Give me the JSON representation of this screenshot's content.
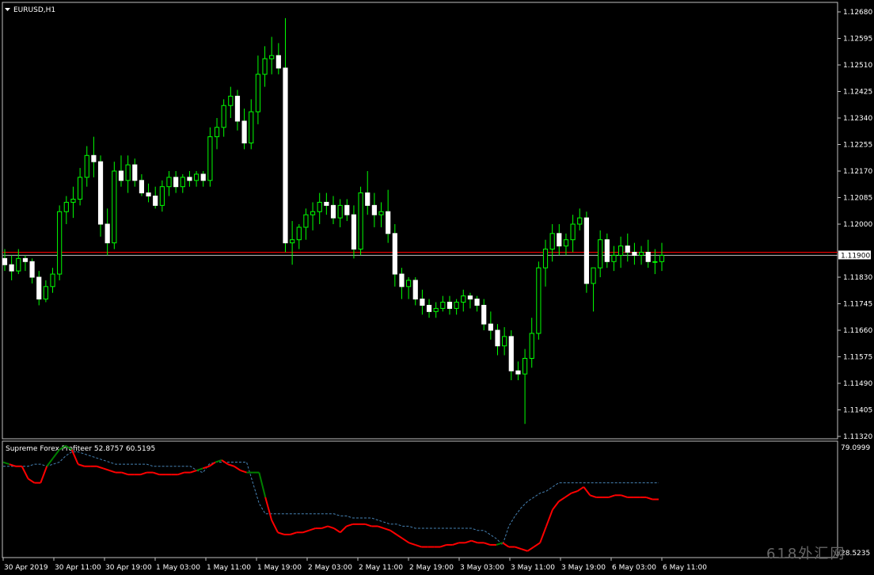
{
  "chart_data": {
    "type": "candlestick",
    "symbol_label": "EURUSD,H1",
    "price_axis_ticks": [
      "1.12680",
      "1.12595",
      "1.12510",
      "1.12425",
      "1.12340",
      "1.12255",
      "1.12170",
      "1.12085",
      "1.12000",
      "1.11830",
      "1.11745",
      "1.11660",
      "1.11575",
      "1.11490",
      "1.11405",
      "1.11320"
    ],
    "price_ylim": [
      1.1132,
      1.1268
    ],
    "current_price_label": "1.11900",
    "current_price": 1.119,
    "bid_line_price": 1.1191,
    "time_axis_ticks": [
      "30 Apr 2019",
      "30 Apr 11:00",
      "30 Apr 19:00",
      "1 May 03:00",
      "1 May 11:00",
      "1 May 19:00",
      "2 May 03:00",
      "2 May 11:00",
      "2 May 19:00",
      "3 May 03:00",
      "3 May 11:00",
      "3 May 19:00",
      "6 May 03:00",
      "6 May 11:00"
    ],
    "candles": [
      [
        1.1189,
        1.1192,
        1.1185,
        1.1187
      ],
      [
        1.1187,
        1.119,
        1.1182,
        1.1185
      ],
      [
        1.1185,
        1.1192,
        1.1184,
        1.1189
      ],
      [
        1.1189,
        1.119,
        1.1185,
        1.1188
      ],
      [
        1.1188,
        1.1189,
        1.1181,
        1.1183
      ],
      [
        1.1183,
        1.1185,
        1.1174,
        1.1176
      ],
      [
        1.1176,
        1.1182,
        1.1175,
        1.118
      ],
      [
        1.118,
        1.1186,
        1.1178,
        1.1184
      ],
      [
        1.1184,
        1.1206,
        1.1182,
        1.1204
      ],
      [
        1.1204,
        1.1209,
        1.12,
        1.1207
      ],
      [
        1.1207,
        1.1212,
        1.1202,
        1.1208
      ],
      [
        1.1208,
        1.1218,
        1.1206,
        1.1215
      ],
      [
        1.1215,
        1.1225,
        1.1212,
        1.1222
      ],
      [
        1.1222,
        1.1228,
        1.1215,
        1.122
      ],
      [
        1.122,
        1.1222,
        1.1196,
        1.12
      ],
      [
        1.12,
        1.1205,
        1.119,
        1.1194
      ],
      [
        1.1194,
        1.122,
        1.1192,
        1.1217
      ],
      [
        1.1217,
        1.1222,
        1.1212,
        1.1214
      ],
      [
        1.1214,
        1.1222,
        1.121,
        1.1219
      ],
      [
        1.1219,
        1.1221,
        1.1212,
        1.1214
      ],
      [
        1.1214,
        1.1216,
        1.1209,
        1.121
      ],
      [
        1.121,
        1.1213,
        1.1207,
        1.1209
      ],
      [
        1.1209,
        1.1212,
        1.1205,
        1.1206
      ],
      [
        1.1206,
        1.1214,
        1.1204,
        1.1212
      ],
      [
        1.1212,
        1.1217,
        1.1209,
        1.1215
      ],
      [
        1.1215,
        1.1217,
        1.121,
        1.1212
      ],
      [
        1.1212,
        1.1216,
        1.121,
        1.1215
      ],
      [
        1.1215,
        1.1217,
        1.1212,
        1.1214
      ],
      [
        1.1214,
        1.1217,
        1.1212,
        1.1216
      ],
      [
        1.1216,
        1.1217,
        1.1212,
        1.1214
      ],
      [
        1.1214,
        1.1231,
        1.1212,
        1.1228
      ],
      [
        1.1228,
        1.1234,
        1.1224,
        1.1231
      ],
      [
        1.1231,
        1.124,
        1.1228,
        1.1238
      ],
      [
        1.1238,
        1.1244,
        1.1234,
        1.1241
      ],
      [
        1.1241,
        1.1243,
        1.123,
        1.1233
      ],
      [
        1.1233,
        1.1237,
        1.1224,
        1.1226
      ],
      [
        1.1226,
        1.124,
        1.1224,
        1.1236
      ],
      [
        1.1236,
        1.1254,
        1.1232,
        1.1248
      ],
      [
        1.1248,
        1.1257,
        1.1244,
        1.1253
      ],
      [
        1.1253,
        1.126,
        1.1248,
        1.1254
      ],
      [
        1.1254,
        1.1258,
        1.1248,
        1.125
      ],
      [
        1.125,
        1.1266,
        1.1191,
        1.1194
      ],
      [
        1.1194,
        1.1201,
        1.1187,
        1.1195
      ],
      [
        1.1195,
        1.12,
        1.1192,
        1.1199
      ],
      [
        1.1199,
        1.1205,
        1.1195,
        1.1203
      ],
      [
        1.1203,
        1.1207,
        1.1198,
        1.1204
      ],
      [
        1.1204,
        1.121,
        1.12,
        1.1207
      ],
      [
        1.1207,
        1.121,
        1.1203,
        1.1206
      ],
      [
        1.1206,
        1.1209,
        1.12,
        1.1202
      ],
      [
        1.1202,
        1.1208,
        1.1199,
        1.1206
      ],
      [
        1.1206,
        1.1208,
        1.1201,
        1.1203
      ],
      [
        1.1203,
        1.1206,
        1.1189,
        1.1192
      ],
      [
        1.1192,
        1.1212,
        1.119,
        1.121
      ],
      [
        1.121,
        1.1217,
        1.1203,
        1.1206
      ],
      [
        1.1206,
        1.121,
        1.1199,
        1.1203
      ],
      [
        1.1203,
        1.1207,
        1.1199,
        1.1204
      ],
      [
        1.1204,
        1.1211,
        1.1194,
        1.1197
      ],
      [
        1.1197,
        1.12,
        1.118,
        1.1184
      ],
      [
        1.1184,
        1.1186,
        1.1176,
        1.118
      ],
      [
        1.118,
        1.1183,
        1.1176,
        1.1182
      ],
      [
        1.1182,
        1.1183,
        1.1174,
        1.1176
      ],
      [
        1.1176,
        1.1179,
        1.1171,
        1.1174
      ],
      [
        1.1174,
        1.1176,
        1.117,
        1.1172
      ],
      [
        1.1172,
        1.1175,
        1.117,
        1.1173
      ],
      [
        1.1173,
        1.1177,
        1.1172,
        1.1175
      ],
      [
        1.1175,
        1.1177,
        1.1171,
        1.1173
      ],
      [
        1.1173,
        1.1176,
        1.1171,
        1.1175
      ],
      [
        1.1175,
        1.1179,
        1.1172,
        1.1177
      ],
      [
        1.1177,
        1.1178,
        1.1173,
        1.1176
      ],
      [
        1.1176,
        1.1177,
        1.1172,
        1.1174
      ],
      [
        1.1174,
        1.1176,
        1.1166,
        1.1168
      ],
      [
        1.1168,
        1.1172,
        1.1163,
        1.1166
      ],
      [
        1.1166,
        1.1168,
        1.1158,
        1.1161
      ],
      [
        1.1161,
        1.1167,
        1.1158,
        1.1164
      ],
      [
        1.1164,
        1.1166,
        1.115,
        1.1153
      ],
      [
        1.1153,
        1.1156,
        1.115,
        1.1152
      ],
      [
        1.1152,
        1.116,
        1.1136,
        1.1157
      ],
      [
        1.1157,
        1.117,
        1.1154,
        1.1165
      ],
      [
        1.1165,
        1.1188,
        1.1163,
        1.1186
      ],
      [
        1.1186,
        1.1195,
        1.118,
        1.1192
      ],
      [
        1.1192,
        1.12,
        1.1188,
        1.1197
      ],
      [
        1.1197,
        1.12,
        1.119,
        1.1193
      ],
      [
        1.1193,
        1.1197,
        1.119,
        1.1195
      ],
      [
        1.1195,
        1.1203,
        1.1191,
        1.12
      ],
      [
        1.12,
        1.1205,
        1.1198,
        1.1202
      ],
      [
        1.1202,
        1.1204,
        1.1178,
        1.1181
      ],
      [
        1.1181,
        1.1186,
        1.1172,
        1.1186
      ],
      [
        1.1186,
        1.1198,
        1.1183,
        1.1195
      ],
      [
        1.1195,
        1.1197,
        1.1186,
        1.1188
      ],
      [
        1.1188,
        1.1193,
        1.1185,
        1.119
      ],
      [
        1.119,
        1.1196,
        1.1186,
        1.1193
      ],
      [
        1.1193,
        1.1197,
        1.1188,
        1.1191
      ],
      [
        1.1191,
        1.1194,
        1.1187,
        1.119
      ],
      [
        1.119,
        1.1193,
        1.1187,
        1.1191
      ],
      [
        1.1191,
        1.1195,
        1.1186,
        1.1188
      ],
      [
        1.1188,
        1.1192,
        1.1184,
        1.1188
      ],
      [
        1.1188,
        1.1194,
        1.1185,
        1.119
      ]
    ]
  },
  "indicator": {
    "label": "Supreme Forex Profiteer 52.8757 60.5195",
    "axis_top_label": "79.0999",
    "axis_bottom_label": "28.5235",
    "ylim": [
      28.5235,
      79.0999
    ],
    "solid": [
      72,
      71,
      70,
      70,
      64,
      62,
      62,
      70,
      74,
      78,
      80,
      78,
      71,
      70,
      70,
      70,
      69,
      68,
      67,
      67,
      66,
      66,
      66,
      67,
      67,
      66,
      66,
      66,
      66,
      67,
      67,
      68,
      69,
      70,
      72,
      73,
      71,
      70,
      68,
      67,
      67,
      67,
      55,
      44,
      38,
      37,
      37,
      38,
      38,
      39,
      40,
      40,
      41,
      40,
      38,
      41,
      42,
      42,
      42,
      41,
      41,
      40,
      39,
      37,
      35,
      33,
      32,
      31,
      31,
      31,
      31,
      32,
      32,
      33,
      33,
      34,
      33,
      33,
      32,
      32,
      33,
      31,
      31,
      30,
      29,
      31,
      33,
      41,
      49,
      53,
      55,
      57,
      58,
      60,
      56,
      55,
      55,
      55,
      56,
      56,
      55,
      55,
      55,
      55,
      54,
      54
    ],
    "colors": "red-green",
    "dashed": [
      70,
      70,
      70,
      70,
      70,
      71,
      71,
      70,
      71,
      72,
      75,
      77,
      77,
      76,
      75,
      74,
      73,
      72,
      71,
      71,
      71,
      71,
      71,
      71,
      70,
      70,
      70,
      70,
      70,
      70,
      70,
      68,
      67,
      71,
      72,
      72,
      72,
      72,
      72,
      72,
      62,
      52,
      47,
      47,
      47,
      47,
      47,
      47,
      47,
      47,
      47,
      47,
      47,
      47,
      46,
      46,
      45,
      45,
      45,
      45,
      44,
      43,
      42,
      42,
      41,
      41,
      40,
      40,
      40,
      40,
      40,
      40,
      40,
      40,
      40,
      40,
      39,
      39,
      37,
      35,
      32,
      41,
      46,
      50,
      53,
      55,
      57,
      58,
      60,
      62,
      62,
      62,
      62,
      62,
      62,
      62,
      62,
      62,
      62,
      62,
      62,
      62,
      62,
      62,
      62,
      62
    ]
  },
  "colors": {
    "background": "#000000",
    "candle_body": "#ffffff",
    "candle_wick": "#00ff00",
    "grid_border": "#c0c0c0",
    "bid_line": "#ff0000",
    "ask_line": "#c0c0c0",
    "indicator_up": "#008000",
    "indicator_down": "#ff0000",
    "indicator_dash": "#4682b4"
  },
  "watermark": "618外汇网"
}
